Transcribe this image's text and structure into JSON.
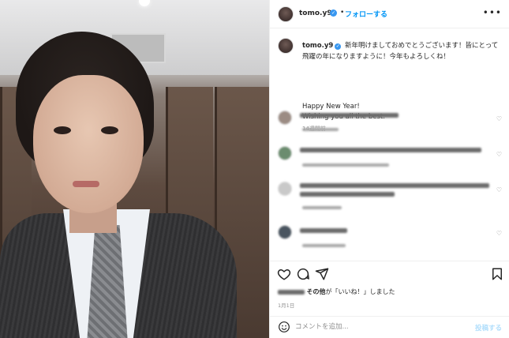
{
  "photo": {
    "alt_icon": "selfie-photo"
  },
  "header": {
    "username": "tomo.y9",
    "verified_glyph": "✓",
    "separator": "•",
    "follow_label": "フォローする",
    "more_glyph": "•••"
  },
  "caption": {
    "username": "tomo.y9",
    "text_ja": "新年明けましておめでとうございます！皆にとって飛躍の年になりますように！今年もよろしくね！",
    "text_en_1": "Happy New Year!",
    "text_en_2": "Wishing you all the best.",
    "time": "14週間前"
  },
  "likes": {
    "suffix_bold": "その他",
    "suffix": "が「いいね！」しました"
  },
  "date": "1月1日",
  "comment_input": {
    "placeholder": "コメントを追加...",
    "post_label": "投稿する"
  },
  "colors": {
    "accent": "#0095f6",
    "verified": "#3897f0",
    "post_disabled": "#b2dffc"
  }
}
